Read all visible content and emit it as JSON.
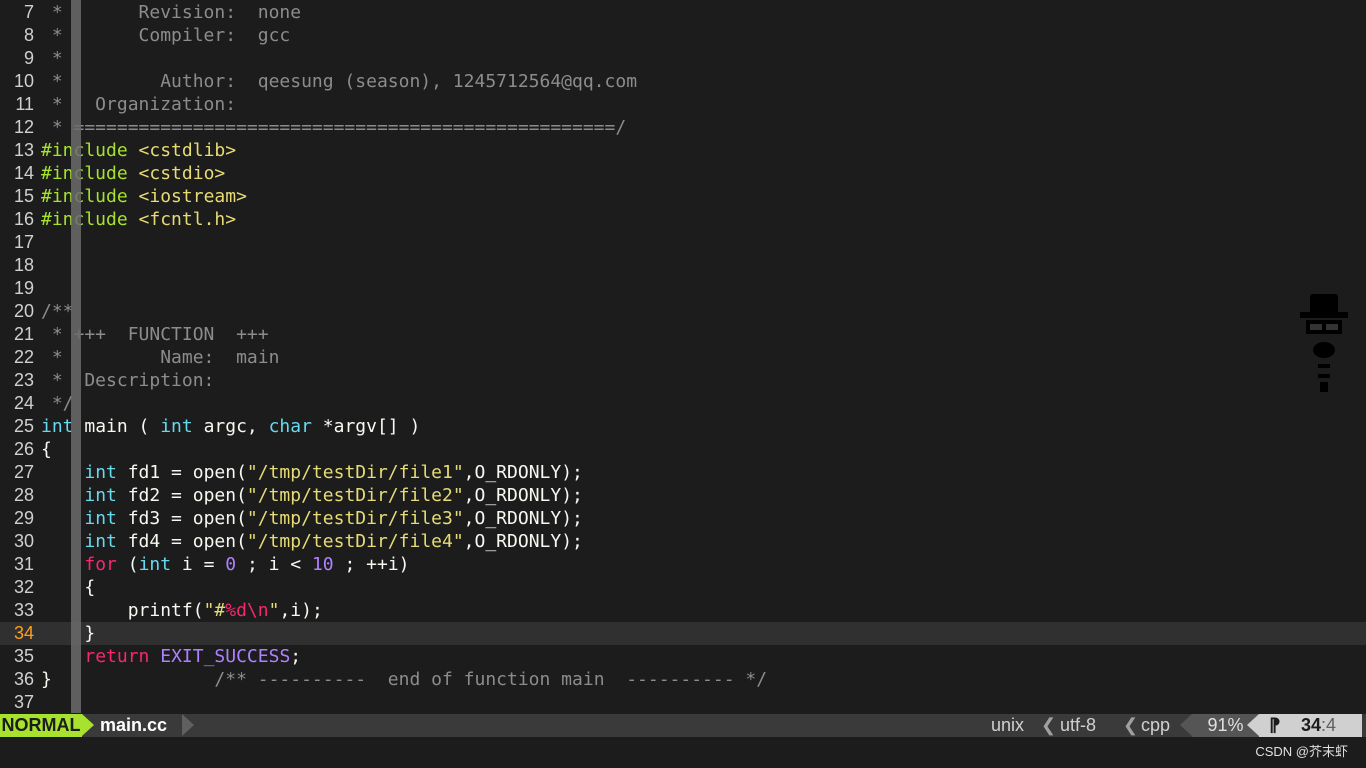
{
  "lines": [
    {
      "n": "7",
      "segs": [
        [
          "cmt",
          " *       Revision:  none"
        ]
      ]
    },
    {
      "n": "8",
      "segs": [
        [
          "cmt",
          " *       Compiler:  gcc"
        ]
      ]
    },
    {
      "n": "9",
      "segs": [
        [
          "cmt",
          " *"
        ]
      ]
    },
    {
      "n": "10",
      "segs": [
        [
          "cmt",
          " *         Author:  qeesung (season), 1245712564@qq.com"
        ]
      ]
    },
    {
      "n": "11",
      "segs": [
        [
          "cmt",
          " *   Organization:"
        ]
      ]
    },
    {
      "n": "12",
      "segs": [
        [
          "cmt",
          " * ==================================================/"
        ]
      ]
    },
    {
      "n": "13",
      "segs": [
        [
          "pre",
          "#include "
        ],
        [
          "inc",
          "<cstdlib>"
        ]
      ]
    },
    {
      "n": "14",
      "segs": [
        [
          "pre",
          "#include "
        ],
        [
          "inc",
          "<cstdio>"
        ]
      ]
    },
    {
      "n": "15",
      "segs": [
        [
          "pre",
          "#include "
        ],
        [
          "inc",
          "<iostream>"
        ]
      ]
    },
    {
      "n": "16",
      "segs": [
        [
          "pre",
          "#include "
        ],
        [
          "inc",
          "<fcntl.h>"
        ]
      ]
    },
    {
      "n": "17",
      "segs": []
    },
    {
      "n": "18",
      "segs": []
    },
    {
      "n": "19",
      "segs": []
    },
    {
      "n": "20",
      "segs": [
        [
          "cmt",
          "/**"
        ]
      ]
    },
    {
      "n": "21",
      "segs": [
        [
          "cmt",
          " * +++  FUNCTION  +++"
        ]
      ]
    },
    {
      "n": "22",
      "segs": [
        [
          "cmt",
          " *         Name:  main"
        ]
      ]
    },
    {
      "n": "23",
      "segs": [
        [
          "cmt",
          " *  Description:"
        ]
      ]
    },
    {
      "n": "24",
      "segs": [
        [
          "cmt",
          " */"
        ]
      ]
    },
    {
      "n": "25",
      "segs": [
        [
          "typ",
          "int"
        ],
        [
          "plain",
          " main ( "
        ],
        [
          "typ",
          "int"
        ],
        [
          "plain",
          " argc, "
        ],
        [
          "typ",
          "char"
        ],
        [
          "plain",
          " *argv[] )"
        ]
      ]
    },
    {
      "n": "26",
      "segs": [
        [
          "plain",
          "{"
        ]
      ]
    },
    {
      "n": "27",
      "segs": [
        [
          "plain",
          "    "
        ],
        [
          "typ",
          "int"
        ],
        [
          "plain",
          " fd1 = open("
        ],
        [
          "str",
          "\"/tmp/testDir/file1\""
        ],
        [
          "plain",
          ",O_RDONLY);"
        ]
      ]
    },
    {
      "n": "28",
      "segs": [
        [
          "plain",
          "    "
        ],
        [
          "typ",
          "int"
        ],
        [
          "plain",
          " fd2 = open("
        ],
        [
          "str",
          "\"/tmp/testDir/file2\""
        ],
        [
          "plain",
          ",O_RDONLY);"
        ]
      ]
    },
    {
      "n": "29",
      "segs": [
        [
          "plain",
          "    "
        ],
        [
          "typ",
          "int"
        ],
        [
          "plain",
          " fd3 = open("
        ],
        [
          "str",
          "\"/tmp/testDir/file3\""
        ],
        [
          "plain",
          ",O_RDONLY);"
        ]
      ]
    },
    {
      "n": "30",
      "segs": [
        [
          "plain",
          "    "
        ],
        [
          "typ",
          "int"
        ],
        [
          "plain",
          " fd4 = open("
        ],
        [
          "str",
          "\"/tmp/testDir/file4\""
        ],
        [
          "plain",
          ",O_RDONLY);"
        ]
      ]
    },
    {
      "n": "31",
      "segs": [
        [
          "plain",
          "    "
        ],
        [
          "kw",
          "for"
        ],
        [
          "plain",
          " ("
        ],
        [
          "typ",
          "int"
        ],
        [
          "plain",
          " i = "
        ],
        [
          "num",
          "0"
        ],
        [
          "plain",
          " ; i < "
        ],
        [
          "num",
          "10"
        ],
        [
          "plain",
          " ; ++i)"
        ]
      ]
    },
    {
      "n": "32",
      "segs": [
        [
          "plain",
          "    {"
        ]
      ]
    },
    {
      "n": "33",
      "segs": [
        [
          "plain",
          "        printf("
        ],
        [
          "str",
          "\"#"
        ],
        [
          "esc",
          "%d\\n"
        ],
        [
          "str",
          "\""
        ],
        [
          "plain",
          ",i);"
        ]
      ]
    },
    {
      "n": "34",
      "segs": [
        [
          "plain",
          "    }"
        ]
      ],
      "current": true
    },
    {
      "n": "35",
      "segs": [
        [
          "plain",
          "    "
        ],
        [
          "kw",
          "return"
        ],
        [
          "plain",
          " "
        ],
        [
          "const",
          "EXIT_SUCCESS"
        ],
        [
          "plain",
          ";"
        ]
      ]
    },
    {
      "n": "36",
      "segs": [
        [
          "plain",
          "}"
        ],
        [
          "cmt",
          "               /** ----------  end of function main  ---------- */"
        ]
      ]
    },
    {
      "n": "37",
      "segs": []
    }
  ],
  "status": {
    "mode": "NORMAL",
    "filename": "main.cc",
    "format": "unix",
    "encoding": "utf-8",
    "filetype": "cpp",
    "percent": "91%",
    "line": "34",
    "col": "4",
    "sep_glyph": "❮",
    "pos_icon": "⁋"
  },
  "watermark": "CSDN @芥末虾",
  "colors": {
    "mode_bg": "#a6e22e",
    "cursorline_nr": "#ff9f1a",
    "background": "#1c1c1c"
  }
}
